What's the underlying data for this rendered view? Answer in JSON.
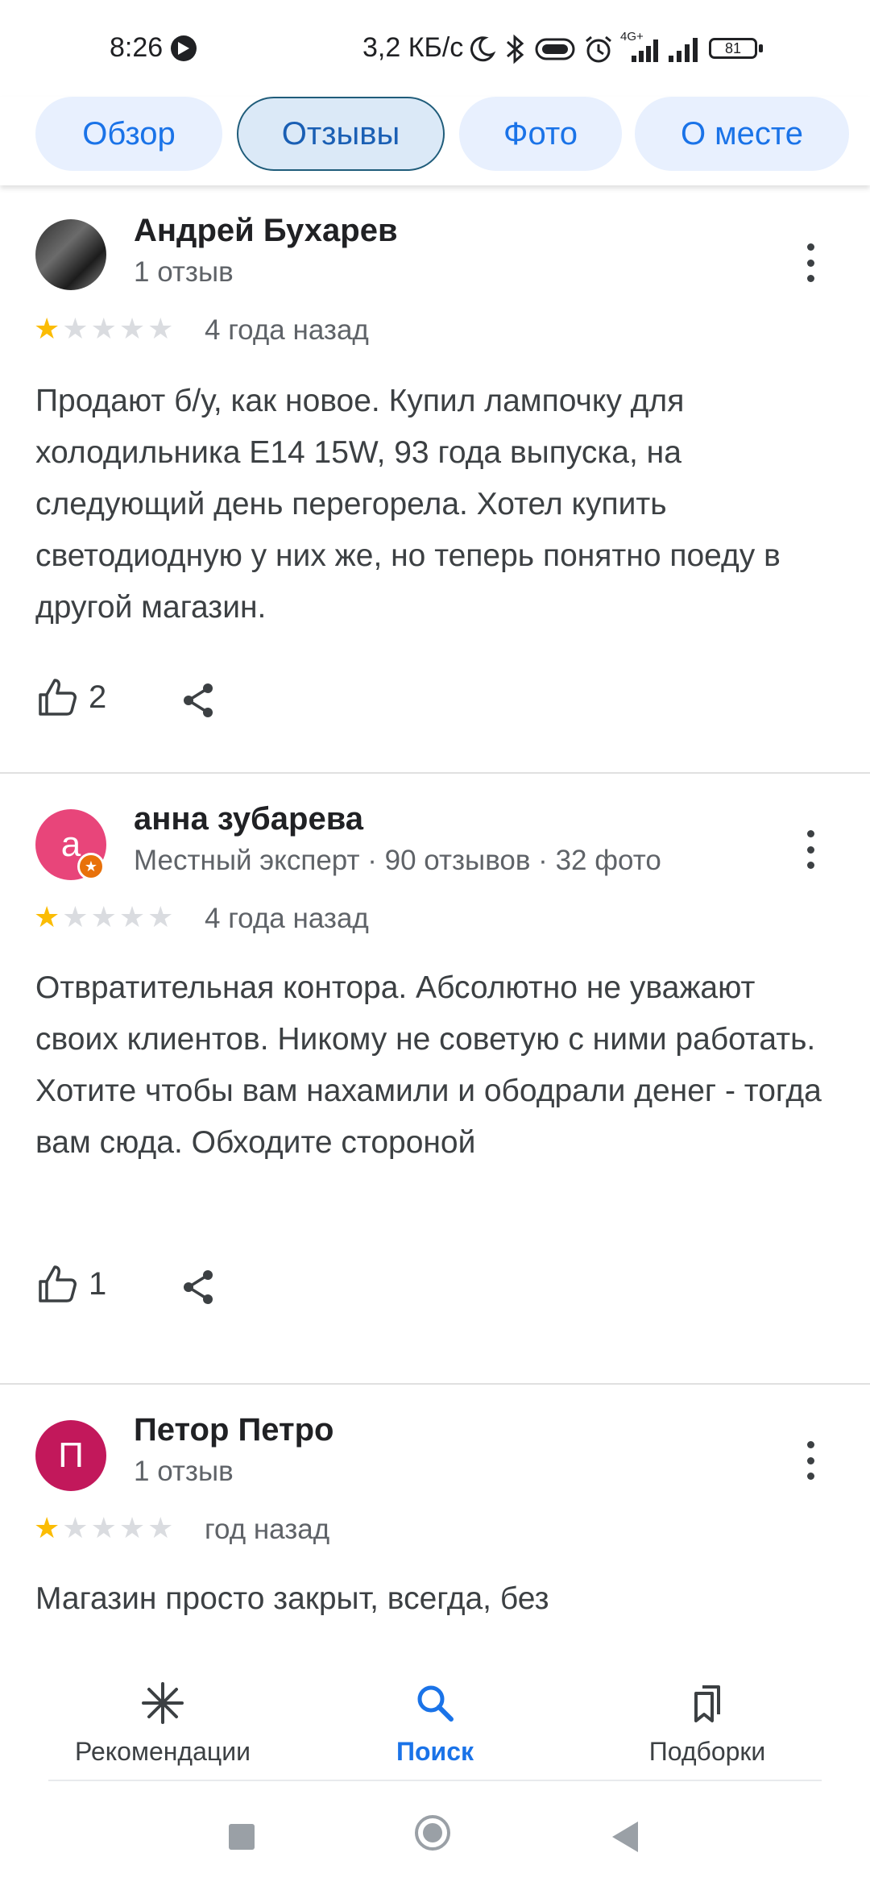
{
  "status_bar": {
    "time": "8:26",
    "net_speed": "3,2 КБ/с",
    "network_type": "4G+",
    "battery": "81"
  },
  "tabs": [
    {
      "label": "Обзор",
      "active": false
    },
    {
      "label": "Отзывы",
      "active": true
    },
    {
      "label": "Фото",
      "active": false
    },
    {
      "label": "О месте",
      "active": false
    }
  ],
  "reviews": [
    {
      "name": "Андрей Бухарев",
      "meta": "1 отзыв",
      "avatar": "photo",
      "rating": 1,
      "date": "4 года назад",
      "text": "Продают б/у, как новое. Купил лампочку для холодильника E14 15W, 93 года выпуска, на следующий день перегорела. Хотел купить светодиодную у них же, но теперь понятно поеду в другой магазин.",
      "likes": "2"
    },
    {
      "name": "анна зубарева",
      "meta": "Местный эксперт · 90 отзывов · 32 фото",
      "avatar": "а",
      "avatar_color": "#e8457a",
      "local_guide": true,
      "rating": 1,
      "date": "4 года назад",
      "text": "Отвратительная контора. Абсолютно не уважают своих клиентов. Никому не советую с ними работать. Хотите чтобы вам нахамили и ободрали денег - тогда вам сюда. Обходите стороной",
      "likes": "1"
    },
    {
      "name": "Петор Петро",
      "meta": "1 отзыв",
      "avatar": "П",
      "avatar_color": "#c2185b",
      "rating": 1,
      "date": "год назад",
      "text": "Магазин просто закрыт, всегда, без"
    }
  ],
  "bottom_nav": [
    {
      "label": "Рекомендации",
      "icon": "sparkle-icon",
      "active": false
    },
    {
      "label": "Поиск",
      "icon": "search-icon",
      "active": true
    },
    {
      "label": "Подборки",
      "icon": "bookmarks-icon",
      "active": false
    }
  ],
  "colors": {
    "accent": "#1a73e8",
    "star": "#fbbc04",
    "tab_bg": "#e8f0fe"
  }
}
